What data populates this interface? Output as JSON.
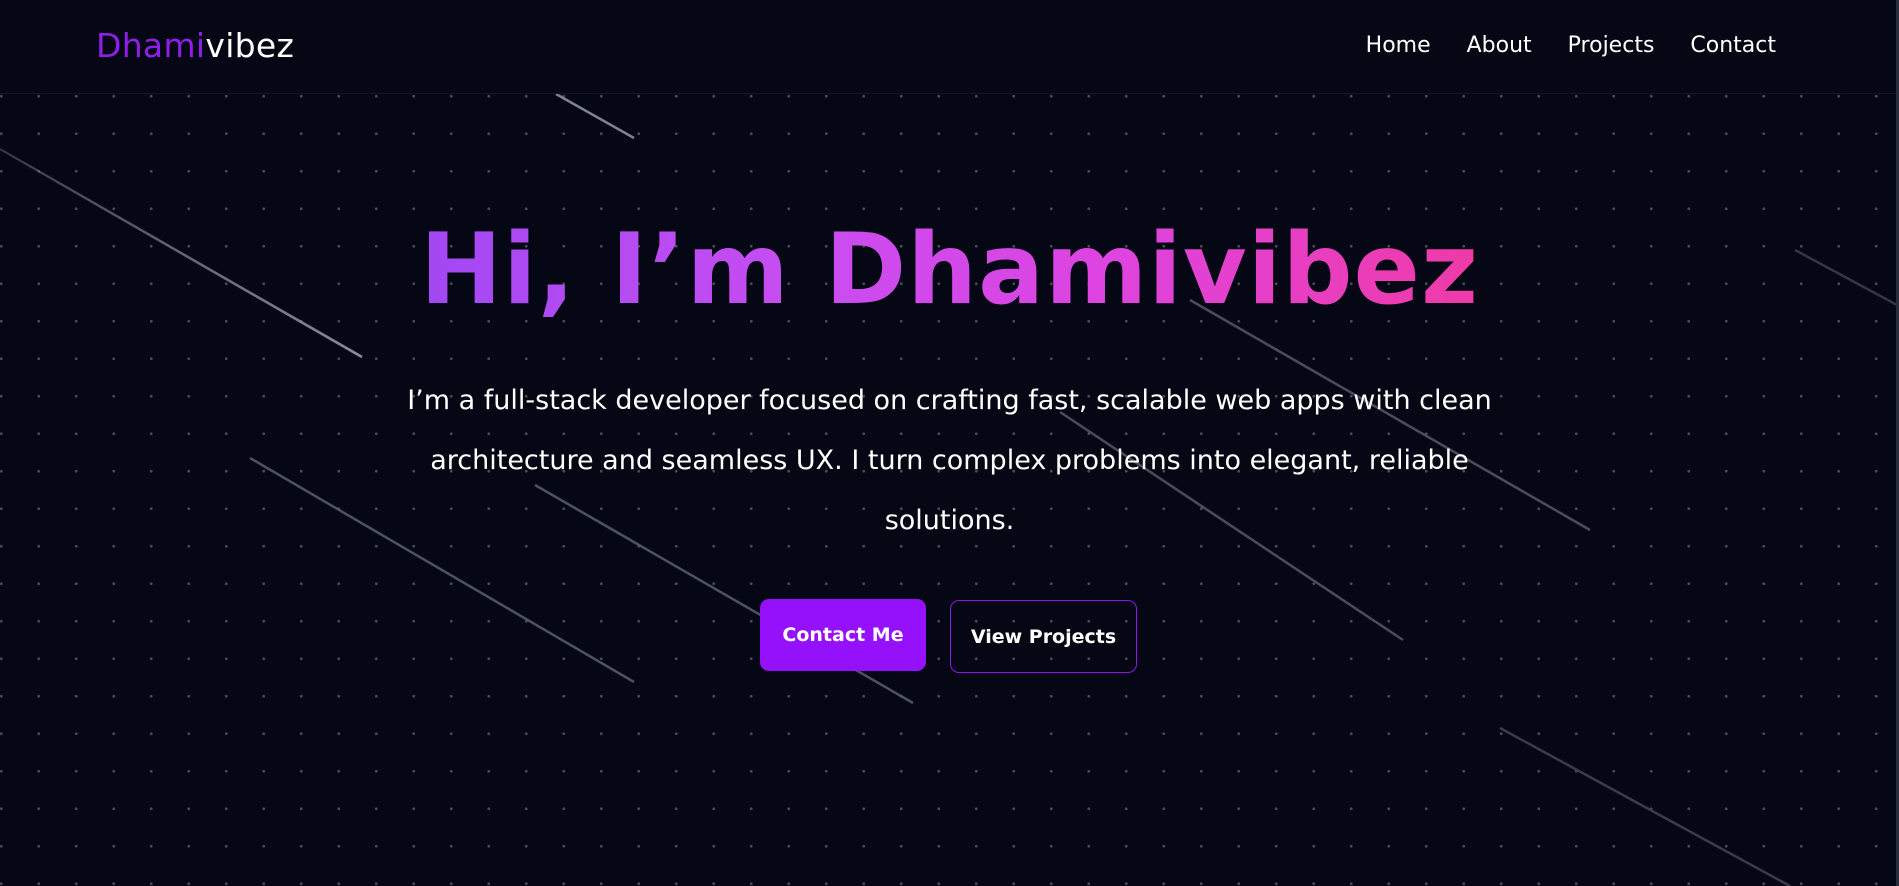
{
  "app": {
    "logo": {
      "part1": "Dhami",
      "part2": "vibez"
    },
    "nav": {
      "items": [
        "Home",
        "About",
        "Projects",
        "Contact"
      ]
    }
  },
  "hero": {
    "title": "Hi, I’m Dhamivibez",
    "subtitle": "I’m a full-stack developer focused on crafting fast, scalable web apps with clean architecture and seamless UX. I turn complex problems into elegant, reliable solutions.",
    "buttons": {
      "primary": "Contact Me",
      "secondary": "View Projects"
    }
  },
  "colors": {
    "background": "#050814",
    "accent": "#9510fb",
    "logo_accent": "#8e1fe8",
    "gradient_start": "#a248f3",
    "gradient_end": "#f03aa7"
  }
}
